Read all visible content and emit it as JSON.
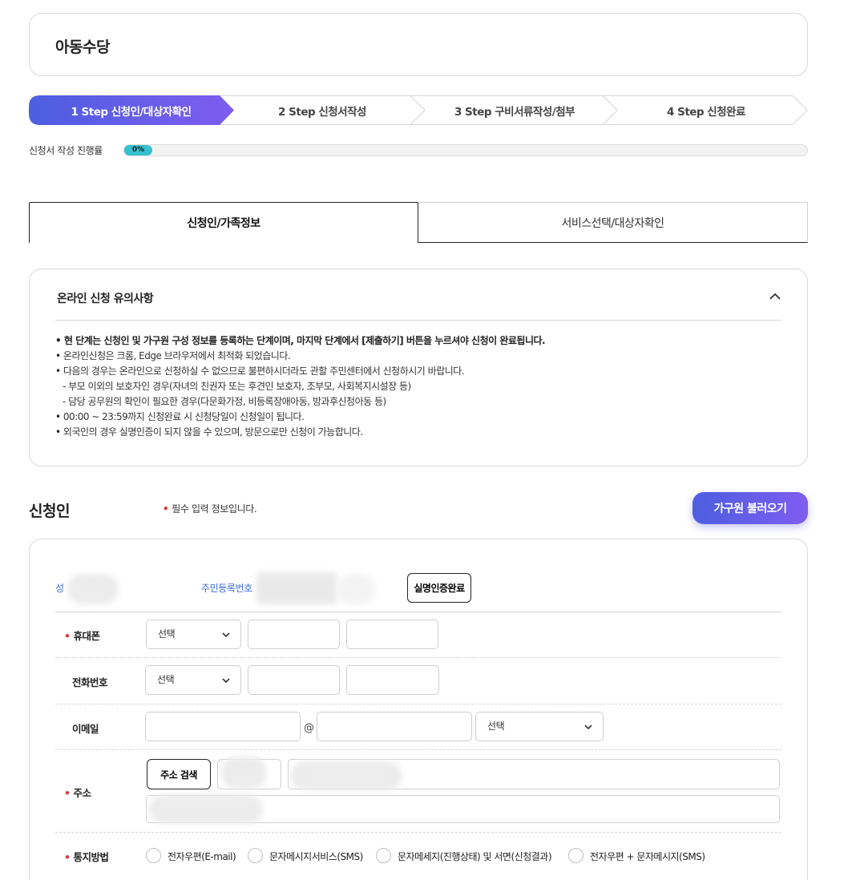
{
  "page": {
    "title": "아동수당"
  },
  "steps": [
    {
      "label": "1 Step 신청인/대상자확인",
      "active": true
    },
    {
      "label": "2 Step 신청서작성",
      "active": false
    },
    {
      "label": "3 Step 구비서류작성/첨부",
      "active": false
    },
    {
      "label": "4 Step 신청완료",
      "active": false
    }
  ],
  "progress": {
    "label": "신청서 작성 진행률",
    "value_text": "0%",
    "value": 0
  },
  "tabs": [
    {
      "label": "신청인/가족정보",
      "active": true
    },
    {
      "label": "서비스선택/대상자확인",
      "active": false
    }
  ],
  "notice": {
    "title": "온라인 신청 유의사항",
    "items": [
      {
        "text": "현 단계는 신청인 및 가구원 구성 정보를 등록하는 단계이며, 마지막 단계에서 [제출하기] 버튼을 누르셔야 신청이 완료됩니다.",
        "bullet": "•",
        "strong": true
      },
      {
        "text": "온라인신청은 크롬, Edge 브라우저에서 최적화 되었습니다.",
        "bullet": "•"
      },
      {
        "text": "다음의 경우는 온라인으로 신청하실 수 없으므로 불편하시더라도 관할 주민센터에서 신청하시기 바랍니다.",
        "bullet": "•"
      },
      {
        "text": "- 부모 이외의 보호자인 경우(자녀의 친권자 또는 후견인 보호자, 조부모, 사회복지시설장 등)",
        "bullet": ""
      },
      {
        "text": "- 담당 공무원의 확인이 필요한 경우(다문화가정, 비등록장애아동, 방과후신청아동 등)",
        "bullet": ""
      },
      {
        "text": "00:00 ~ 23:59까지 신청완료 시 신청당일이 신청일이 됩니다.",
        "bullet": "•"
      },
      {
        "text": "외국인의 경우 실명인증이 되지 않을 수 있으며, 방문으로만 신청이 가능합니다.",
        "bullet": "•"
      }
    ],
    "collapse_icon": "chevron-up-icon"
  },
  "applicant": {
    "section_title": "신청인",
    "required_mark": "•",
    "required_note": "필수 입력 정보입니다.",
    "family_button": "가구원 불러오기",
    "name_label": "성",
    "rrn_label": "주민등록번호",
    "verify_button": "실명인증완료",
    "mobile": {
      "label": "휴대폰",
      "required": true,
      "select_value": "선택"
    },
    "phone": {
      "label": "전화번호",
      "required": false,
      "select_value": "선택"
    },
    "email": {
      "label": "이메일",
      "at": "@",
      "select_value": "선택"
    },
    "address": {
      "label": "주소",
      "required": true,
      "search_button": "주소 검색"
    },
    "notify": {
      "label": "통지방법",
      "required": true,
      "options": [
        "전자우편(E-mail)",
        "문자메시지서비스(SMS)",
        "문자메세지(진행상태) 및 서면(신청결과)",
        "전자우편 + 문자메시지(SMS)"
      ]
    }
  },
  "colors": {
    "accent_start": "#4c5fe0",
    "accent_end": "#7f5cf0",
    "progress": "#35c0cf",
    "required": "#e0353b",
    "link_label": "#3a6cd8"
  }
}
